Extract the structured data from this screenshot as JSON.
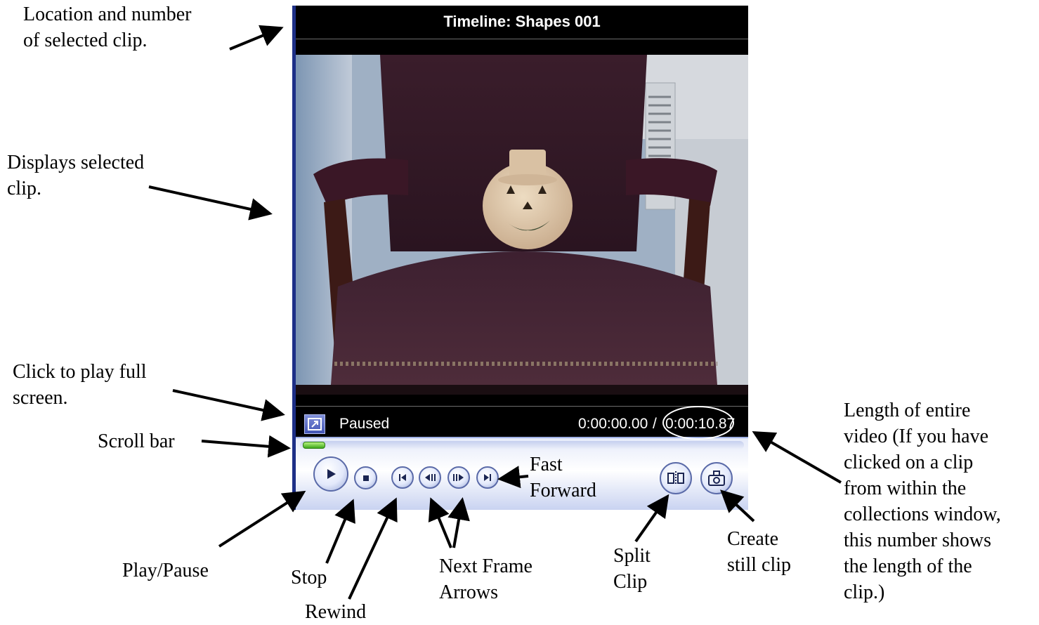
{
  "player": {
    "title": "Timeline: Shapes 001",
    "status": "Paused",
    "current_time": "0:00:00.00",
    "separator": "/",
    "total_time": "0:00:10.87",
    "scroll_position_fraction": 0.0
  },
  "annotations": {
    "location": "Location and number\nof selected clip.",
    "displays": "Displays selected\nclip.",
    "fullscreen": "Click to play full\nscreen.",
    "scrollbar": "Scroll bar",
    "length": "Length of entire\nvideo (If you have\nclicked on a clip\nfrom within the\ncollections window,\nthis number shows\nthe length of the\nclip.)",
    "fast_forward": "Fast\nForward",
    "play_pause": "Play/Pause",
    "stop": "Stop",
    "rewind": "Rewind",
    "next_frame": "Next Frame\nArrows",
    "split": "Split\nClip",
    "still": "Create\nstill clip"
  },
  "icons": {
    "fullscreen": "fullscreen-icon",
    "play": "play-icon",
    "stop": "stop-icon",
    "rewind": "rewind-icon",
    "previous_frame": "previous-frame-icon",
    "next_frame": "next-frame-icon",
    "fast_forward": "fast-forward-icon",
    "split": "split-clip-icon",
    "snapshot": "camera-icon"
  },
  "colors": {
    "player_border": "#1d2f87",
    "scroll_thumb": "#3fa81c"
  }
}
